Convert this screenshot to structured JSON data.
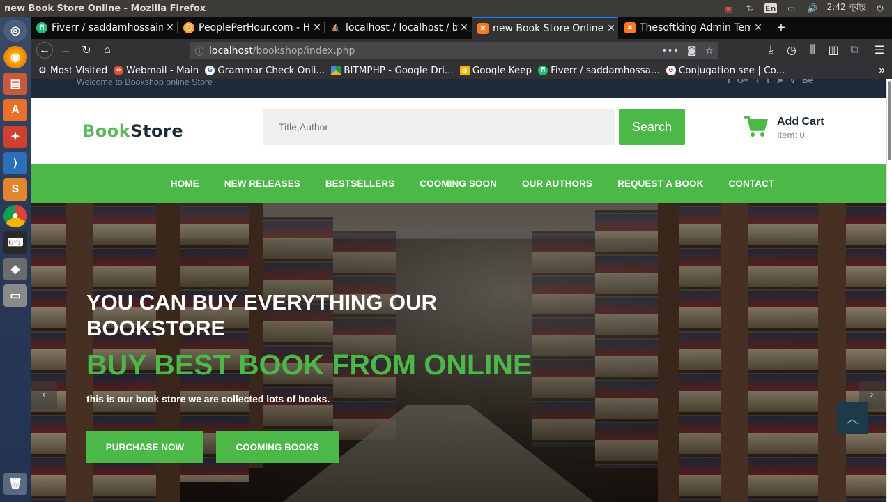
{
  "os": {
    "window_title": "new Book Store Online - Mozilla Firefox",
    "keyboard_layout": "En",
    "clock": "2:42 পূর্বাহ্ণ"
  },
  "browser": {
    "tabs": [
      {
        "label": "Fiverr / saddamhossain",
        "favicon": "fiverr-icon",
        "active": false
      },
      {
        "label": "PeoplePerHour.com - Hi",
        "favicon": "peopleperhour-icon",
        "active": false
      },
      {
        "label": "localhost / localhost / bo",
        "favicon": "phpmyadmin-icon",
        "active": false
      },
      {
        "label": "new Book Store Online",
        "favicon": "xampp-icon",
        "active": true
      },
      {
        "label": "Thesoftking Admin Tem",
        "favicon": "xampp-icon",
        "active": false
      }
    ],
    "url_host": "localhost",
    "url_path": "/bookshop/index.php",
    "bookmarks": [
      {
        "label": "Most Visited",
        "icon": "gear-icon"
      },
      {
        "label": "Webmail - Main",
        "icon": "webmail-icon"
      },
      {
        "label": "Grammar Check Onli...",
        "icon": "grammar-icon"
      },
      {
        "label": "BITMPHP - Google Dri...",
        "icon": "drive-icon"
      },
      {
        "label": "Google Keep",
        "icon": "keep-icon"
      },
      {
        "label": "Fiverr / saddamhossa...",
        "icon": "fiverr-icon"
      },
      {
        "label": "Conjugation see | Co...",
        "icon": "conjugation-icon"
      }
    ]
  },
  "site": {
    "welcome": "Welcome to Bookshop online Store",
    "logo_part1": "Book",
    "logo_part2": "Store",
    "search_placeholder": "Title,Author",
    "search_label": "Search",
    "cart_title": "Add Cart",
    "cart_items": "Item: 0",
    "menu": [
      "HOME",
      "NEW RELEASES",
      "BESTSELLERS",
      "COOMING SOON",
      "OUR AUTHORS",
      "REQUEST A BOOK",
      "CONTACT"
    ],
    "hero": {
      "headline": "YOU CAN BUY EVERYTHING OUR BOOKSTORE",
      "subheadline": "BUY BEST BOOK FROM ONLINE",
      "text": "this is our book store we are collected lots of books.",
      "button_primary": "PURCHASE NOW",
      "button_secondary": "COOMING BOOKS"
    }
  },
  "colors": {
    "brand_green": "#4cb848",
    "dark_navy": "#1c2a3a",
    "tab_accent": "#0a84ff"
  }
}
